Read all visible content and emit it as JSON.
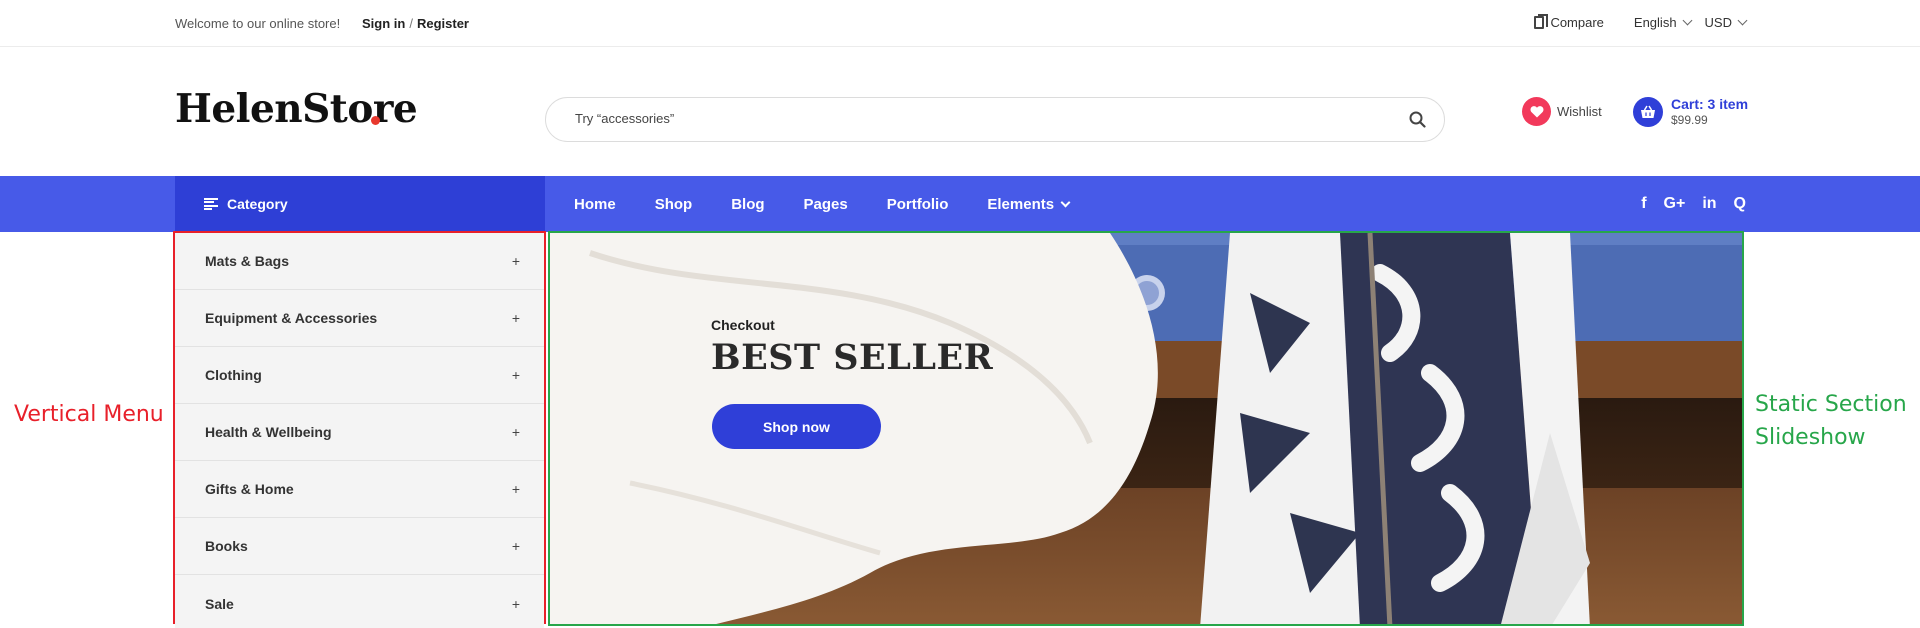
{
  "topbar": {
    "welcome": "Welcome to our online store!",
    "sign_in": "Sign in",
    "separator": "/",
    "register": "Register",
    "compare": "Compare",
    "language": "English",
    "currency": "USD"
  },
  "header": {
    "logo": "HelenStore",
    "logo_dot_color": "#e8382e",
    "search_placeholder": "Try “accessories”",
    "wishlist": "Wishlist",
    "cart_title": "Cart: 3 item",
    "cart_total": "$99.99"
  },
  "nav": {
    "category": "Category",
    "links": [
      "Home",
      "Shop",
      "Blog",
      "Pages",
      "Portfolio",
      "Elements"
    ],
    "social": [
      "facebook-icon",
      "google-plus-icon",
      "linkedin-icon",
      "quora-icon"
    ]
  },
  "vertical_menu": {
    "items": [
      "Mats & Bags",
      "Equipment & Accessories",
      "Clothing",
      "Health & Wellbeing",
      "Gifts & Home",
      "Books",
      "Sale"
    ],
    "expand_symbol": "+"
  },
  "slide": {
    "subtitle": "Checkout",
    "title": "BEST SELLER",
    "button": "Shop now"
  },
  "annotations": {
    "vertical_menu": "Vertical Menu",
    "slideshow_line1": "Static Section",
    "slideshow_line2": "Slideshow"
  },
  "colors": {
    "primary": "#2f3fd8",
    "nav_bg": "#475ae8",
    "category_bg": "#2e3fd6",
    "wishlist_accent": "#f2395b",
    "annotation_red": "#e8202a",
    "annotation_green": "#27a64a"
  }
}
